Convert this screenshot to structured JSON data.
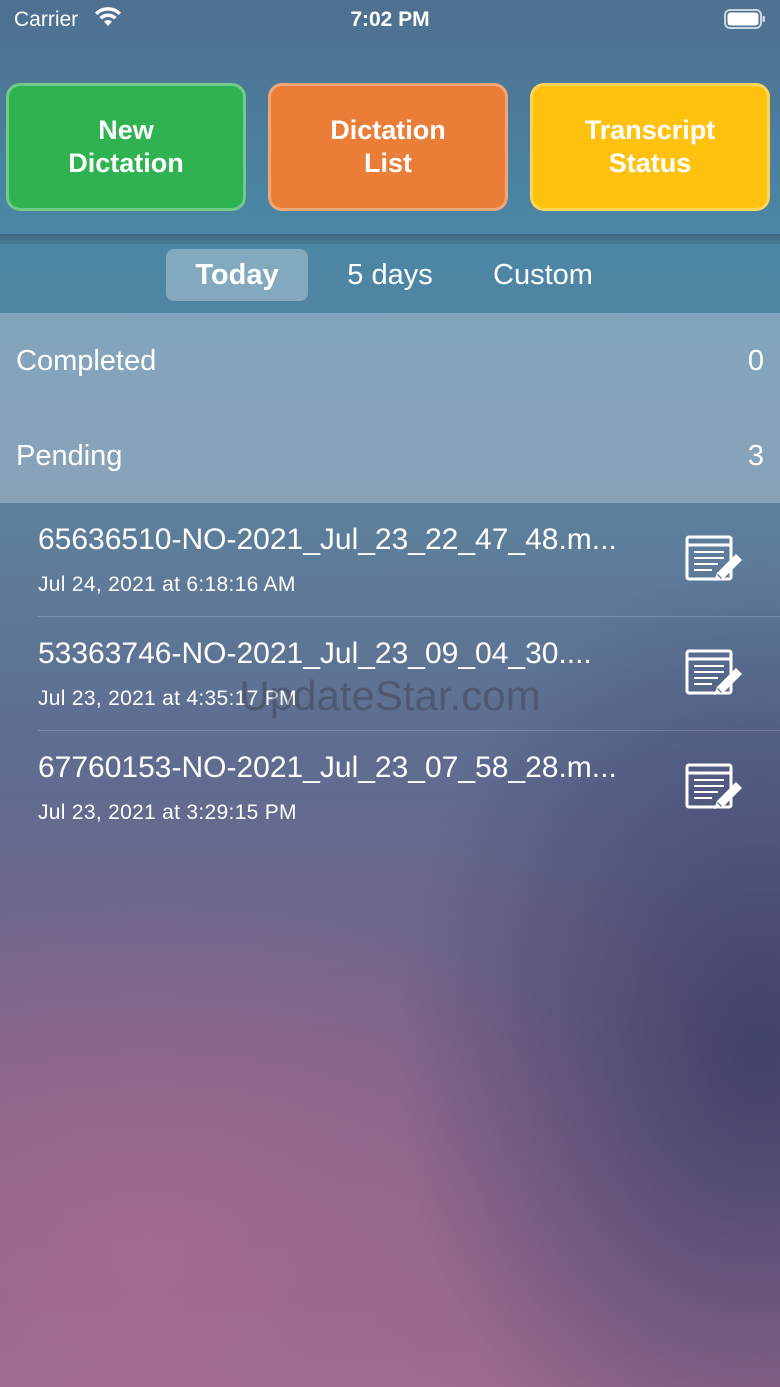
{
  "status_bar": {
    "carrier": "Carrier",
    "time": "7:02 PM",
    "icons": [
      "wifi-icon",
      "battery-icon"
    ]
  },
  "actions": {
    "new_dictation": "New\nDictation",
    "dictation_list": "Dictation\nList",
    "transcript_status": "Transcript\nStatus",
    "colors": {
      "new": "#2fb351",
      "list": "#ea7d37",
      "status": "#fec20e"
    }
  },
  "filter": {
    "segments": [
      "Today",
      "5 days",
      "Custom"
    ],
    "selected": "Today"
  },
  "summary": {
    "completed_label": "Completed",
    "completed_count": "0",
    "pending_label": "Pending",
    "pending_count": "3"
  },
  "items": [
    {
      "name": "65636510-NO-2021_Jul_23_22_47_48.m...",
      "date": "Jul 24, 2021 at 6:18:16 AM",
      "icon": "edit-document-icon"
    },
    {
      "name": "53363746-NO-2021_Jul_23_09_04_30....",
      "date": "Jul 23, 2021 at 4:35:17 PM",
      "icon": "edit-document-icon"
    },
    {
      "name": "67760153-NO-2021_Jul_23_07_58_28.m...",
      "date": "Jul 23, 2021 at 3:29:15 PM",
      "icon": "edit-document-icon"
    }
  ],
  "watermark": "UpdateStar.com"
}
